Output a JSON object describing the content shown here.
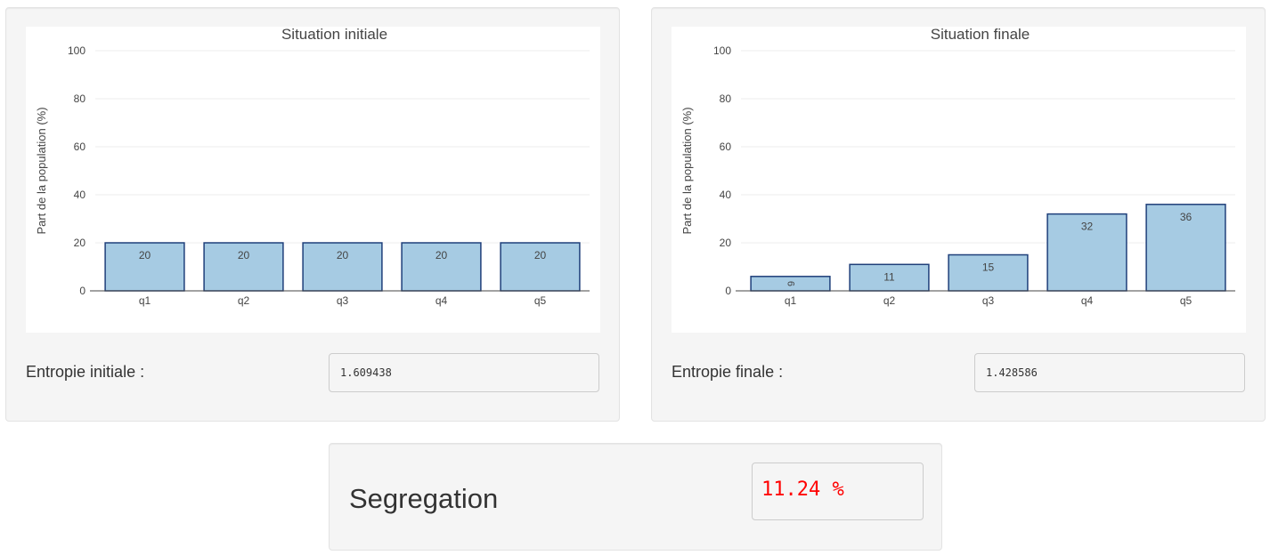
{
  "left_panel": {
    "entropy_label": "Entropie initiale :",
    "entropy_value": "1.609438"
  },
  "right_panel": {
    "entropy_label": "Entropie finale :",
    "entropy_value": "1.428586"
  },
  "segregation": {
    "label": "Segregation",
    "value": "11.24 %",
    "value_color": "#ff0000"
  },
  "chart_data": [
    {
      "type": "bar",
      "title": "Situation initiale",
      "xlabel": "",
      "ylabel": "Part de la population (%)",
      "categories": [
        "q1",
        "q2",
        "q3",
        "q4",
        "q5"
      ],
      "values": [
        20,
        20,
        20,
        20,
        20
      ],
      "data_labels": [
        "20",
        "20",
        "20",
        "20",
        "20"
      ],
      "ylim": [
        0,
        100
      ],
      "yticks": [
        0,
        20,
        40,
        60,
        80,
        100
      ],
      "grid": true,
      "bar_color": "#a6cbe3",
      "bar_outline": "#1f3f7a"
    },
    {
      "type": "bar",
      "title": "Situation finale",
      "xlabel": "",
      "ylabel": "Part de la population (%)",
      "categories": [
        "q1",
        "q2",
        "q3",
        "q4",
        "q5"
      ],
      "values": [
        6,
        11,
        15,
        32,
        36
      ],
      "data_labels": [
        "6",
        "11",
        "15",
        "32",
        "36"
      ],
      "ylim": [
        0,
        100
      ],
      "yticks": [
        0,
        20,
        40,
        60,
        80,
        100
      ],
      "grid": true,
      "bar_color": "#a6cbe3",
      "bar_outline": "#1f3f7a"
    }
  ]
}
